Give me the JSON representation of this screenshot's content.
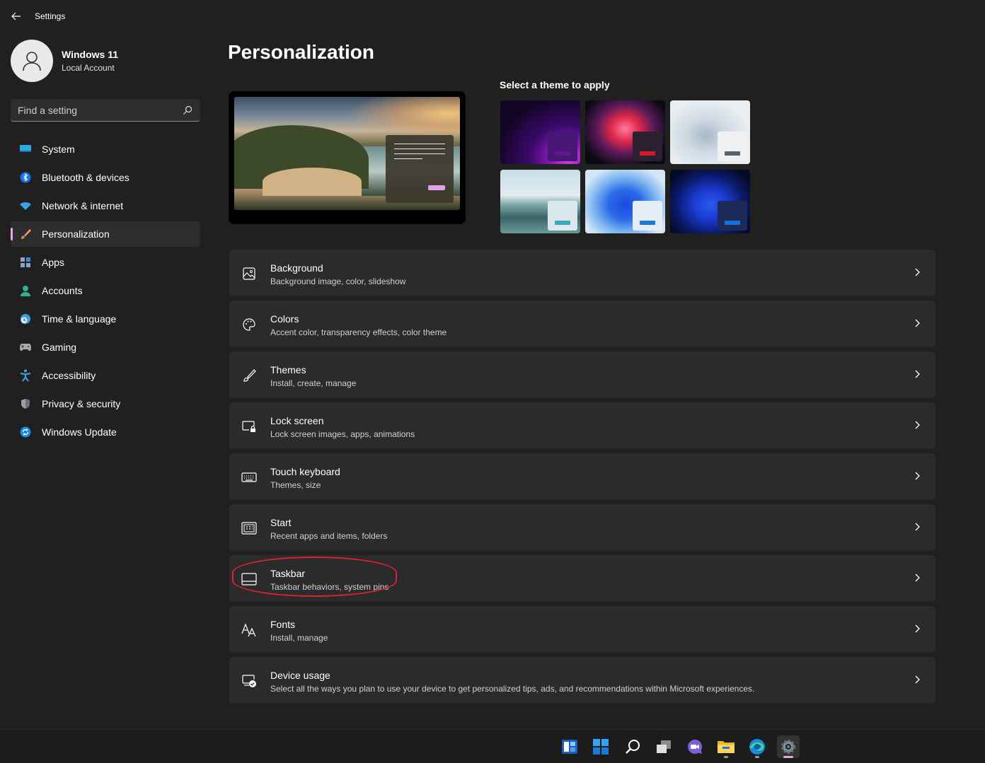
{
  "window": {
    "title": "Settings"
  },
  "profile": {
    "name": "Windows 11",
    "account_type": "Local Account"
  },
  "search": {
    "placeholder": "Find a setting"
  },
  "nav": {
    "items": [
      {
        "label": "System",
        "icon": "monitor-icon"
      },
      {
        "label": "Bluetooth & devices",
        "icon": "bluetooth-icon"
      },
      {
        "label": "Network & internet",
        "icon": "wifi-icon"
      },
      {
        "label": "Personalization",
        "icon": "paintbrush-icon",
        "active": true
      },
      {
        "label": "Apps",
        "icon": "apps-icon"
      },
      {
        "label": "Accounts",
        "icon": "person-icon"
      },
      {
        "label": "Time & language",
        "icon": "clock-globe-icon"
      },
      {
        "label": "Gaming",
        "icon": "gamepad-icon"
      },
      {
        "label": "Accessibility",
        "icon": "accessibility-icon"
      },
      {
        "label": "Privacy & security",
        "icon": "shield-icon"
      },
      {
        "label": "Windows Update",
        "icon": "update-icon"
      }
    ]
  },
  "page": {
    "title": "Personalization"
  },
  "themes": {
    "heading": "Select a theme to apply",
    "items": [
      {
        "name": "purple-glow-theme",
        "accent": "#5a1a8c"
      },
      {
        "name": "flower-theme",
        "accent": "#d11a2a"
      },
      {
        "name": "light-bloom-theme",
        "accent": "#5a6068"
      },
      {
        "name": "lake-theme",
        "accent": "#3fa8b8"
      },
      {
        "name": "blue-bloom-light-theme",
        "accent": "#1a7ad4"
      },
      {
        "name": "blue-bloom-dark-theme",
        "accent": "#1a6fd0"
      }
    ]
  },
  "settings": {
    "items": [
      {
        "title": "Background",
        "desc": "Background image, color, slideshow",
        "icon": "image-icon"
      },
      {
        "title": "Colors",
        "desc": "Accent color, transparency effects, color theme",
        "icon": "palette-icon"
      },
      {
        "title": "Themes",
        "desc": "Install, create, manage",
        "icon": "brush-icon"
      },
      {
        "title": "Lock screen",
        "desc": "Lock screen images, apps, animations",
        "icon": "lock-screen-icon"
      },
      {
        "title": "Touch keyboard",
        "desc": "Themes, size",
        "icon": "keyboard-icon"
      },
      {
        "title": "Start",
        "desc": "Recent apps and items, folders",
        "icon": "start-icon"
      },
      {
        "title": "Taskbar",
        "desc": "Taskbar behaviors, system pins",
        "icon": "taskbar-icon"
      },
      {
        "title": "Fonts",
        "desc": "Install, manage",
        "icon": "fonts-icon"
      },
      {
        "title": "Device usage",
        "desc": "Select all the ways you plan to use your device to get personalized tips, ads, and recommendations within Microsoft experiences.",
        "icon": "device-usage-icon"
      }
    ]
  },
  "taskbar": {
    "icons": [
      "widgets-icon",
      "start-icon",
      "search-icon",
      "task-view-icon",
      "chat-icon",
      "file-explorer-icon",
      "edge-icon",
      "settings-icon"
    ],
    "active": "settings-icon"
  },
  "colors": {
    "accent": "#e5a6e5",
    "highlight": "#d9232e",
    "background": "#202020",
    "card": "#2b2b2b"
  }
}
